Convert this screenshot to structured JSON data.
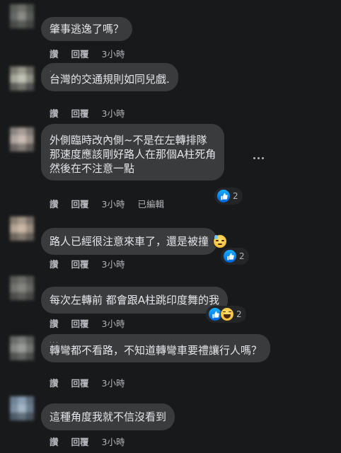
{
  "comments": [
    {
      "author_hint": "",
      "lines": [
        "肇事逃逸了嗎？"
      ],
      "actions": {
        "like": "讚",
        "reply": "回覆",
        "time": "3小時"
      }
    },
    {
      "author_hint": ".",
      "lines": [
        "台灣的交通規則如同兒戲."
      ],
      "actions": {
        "like": "讚",
        "reply": "回覆",
        "time": "3小時"
      }
    },
    {
      "author_hint": "",
      "lines": [
        "外側臨時改內側~不是在左轉排隊",
        "那速度應該剛好路人在那個A柱死角",
        "然後在不注意一點"
      ],
      "actions": {
        "like": "讚",
        "reply": "回覆",
        "time": "3小時",
        "edited": "已編輯"
      },
      "reactions": {
        "icons": [
          "like-icon"
        ],
        "count": "2"
      }
    },
    {
      "author_hint": "",
      "lines": [
        "路人已經很注意來車了，還是被撞"
      ],
      "actions": {
        "like": "讚",
        "reply": "回覆",
        "time": "3小時"
      },
      "reactions": {
        "icons": [
          "like-icon"
        ],
        "count": "2"
      }
    },
    {
      "author_hint": "",
      "lines": [
        "每次左轉前 都會跟A柱跳印度舞的我"
      ],
      "actions": {
        "like": "讚",
        "reply": "回覆",
        "time": "3小時"
      },
      "reactions": {
        "icons": [
          "like-icon",
          "haha-icon"
        ],
        "count": "2"
      }
    },
    {
      "author_hint": "...",
      "lines": [
        "轉彎都不看路，不知道轉彎車要禮讓行人嗎？"
      ],
      "actions": {
        "like": "讚",
        "reply": "回覆",
        "time": "3小時"
      }
    },
    {
      "author_hint": "",
      "lines": [
        "這種角度我就不信沒看到"
      ],
      "actions": {
        "like": "讚",
        "reply": "回覆",
        "time": "3小時"
      }
    }
  ],
  "colors": {
    "background": "#18191a",
    "bubble": "#3a3b3c",
    "text": "#e4e6eb",
    "muted": "#b0b3b8",
    "like": "#1877f2"
  }
}
